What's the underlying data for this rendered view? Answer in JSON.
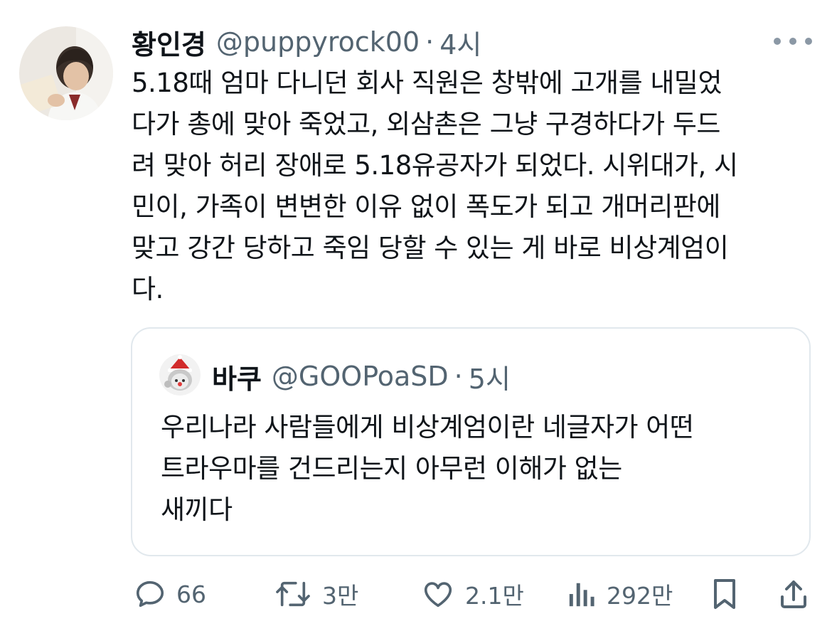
{
  "tweet": {
    "author_name": "황인경",
    "author_handle": "@puppyrock00",
    "separator": "·",
    "time": "4시",
    "text_lines": [
      "5.18때 엄마 다니던 회사 직원은 창밖에 고개를 내밀었",
      "다가 총에 맞아 죽었고, 외삼촌은 그냥 구경하다가 두드",
      "려 맞아 허리 장애로 5.18유공자가 되었다. 시위대가, 시",
      "민이, 가족이 변변한 이유 없이 폭도가 되고 개머리판에",
      "맞고 강간 당하고 죽임 당할 수 있는 게 바로 비상계엄이",
      "다."
    ]
  },
  "quote": {
    "author_name": "바쿠",
    "author_handle": "@GOOPoaSD",
    "separator": "·",
    "time": "5시",
    "text_lines": [
      "우리나라 사람들에게 비상계엄이란 네글자가 어떤",
      "트라우마를 건드리는지 아무런 이해가 없는",
      "새끼다"
    ]
  },
  "actions": {
    "replies": "66",
    "retweets": "3만",
    "likes": "2.1만",
    "views": "292만"
  },
  "icons": {
    "more": "more-dots-icon",
    "reply": "reply-bubble-icon",
    "retweet": "retweet-icon",
    "like": "heart-icon",
    "views": "views-chart-icon",
    "bookmark": "bookmark-icon",
    "share": "share-icon"
  },
  "colors": {
    "text": "#0f1419",
    "secondary": "#536471",
    "border": "#e1e8ed"
  }
}
